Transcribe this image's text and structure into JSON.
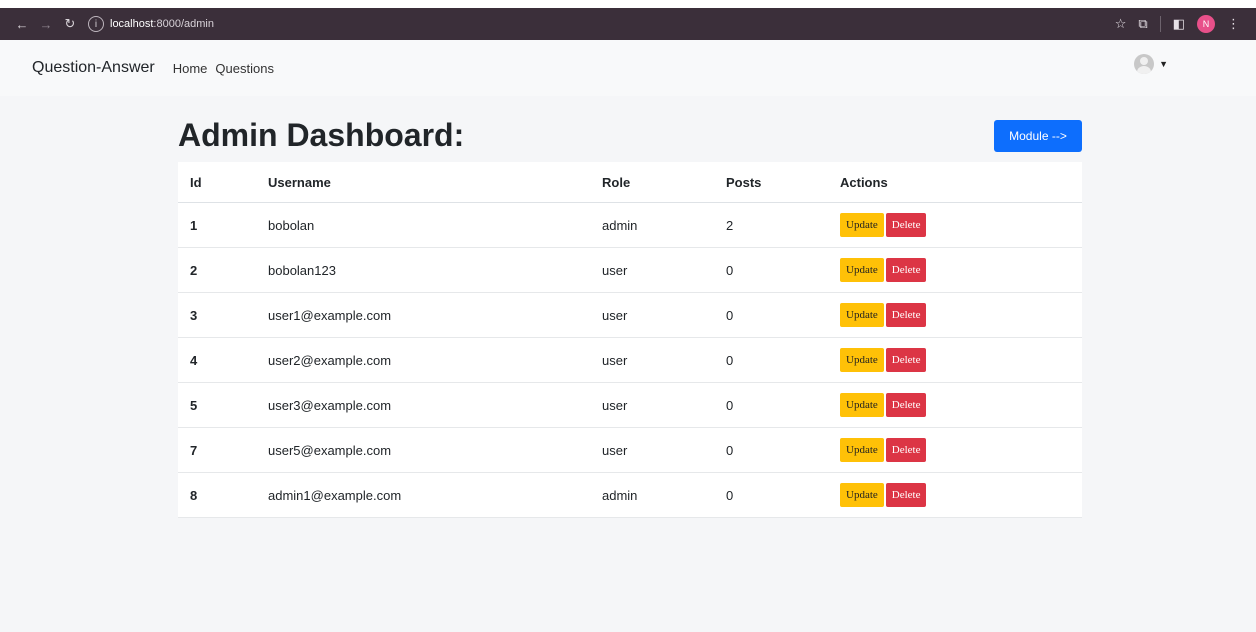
{
  "browser": {
    "url_host": "localhost",
    "url_path": ":8000/admin",
    "profile_initial": "N"
  },
  "navbar": {
    "brand": "Question-Answer",
    "links": [
      "Home",
      "Questions"
    ]
  },
  "page": {
    "title": "Admin Dashboard:",
    "module_button": "Module -->"
  },
  "table": {
    "headers": [
      "Id",
      "Username",
      "Role",
      "Posts",
      "Actions"
    ],
    "rows": [
      {
        "id": "1",
        "username": "bobolan",
        "role": "admin",
        "posts": "2"
      },
      {
        "id": "2",
        "username": "bobolan123",
        "role": "user",
        "posts": "0"
      },
      {
        "id": "3",
        "username": "user1@example.com",
        "role": "user",
        "posts": "0"
      },
      {
        "id": "4",
        "username": "user2@example.com",
        "role": "user",
        "posts": "0"
      },
      {
        "id": "5",
        "username": "user3@example.com",
        "role": "user",
        "posts": "0"
      },
      {
        "id": "7",
        "username": "user5@example.com",
        "role": "user",
        "posts": "0"
      },
      {
        "id": "8",
        "username": "admin1@example.com",
        "role": "admin",
        "posts": "0"
      }
    ],
    "update_label": "Update",
    "delete_label": "Delete"
  },
  "colors": {
    "primary": "#0d6efd",
    "warning": "#ffc107",
    "danger": "#dc3545"
  }
}
